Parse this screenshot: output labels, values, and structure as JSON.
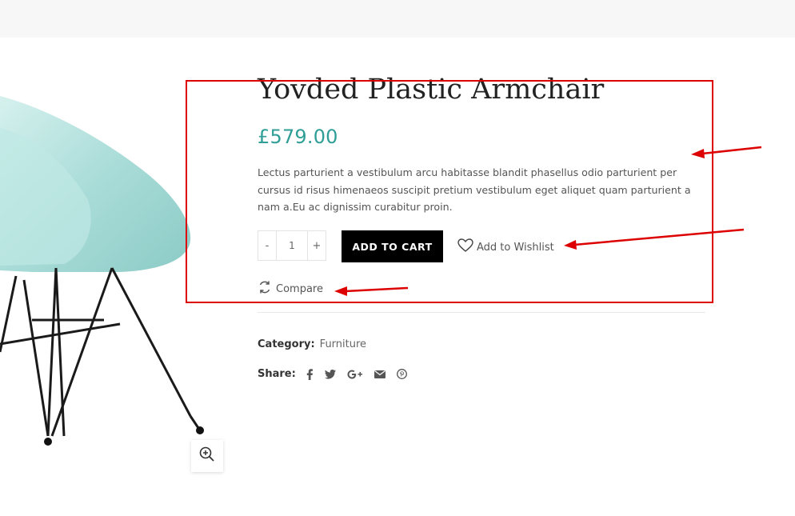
{
  "product": {
    "title": "Yovded Plastic Armchair",
    "price": "£579.00",
    "description": "Lectus parturient a vestibulum arcu habitasse blandit phasellus odio parturient per cursus id risus himenaeos suscipit pretium vestibulum eget aliquet quam parturient a nam a.Eu ac dignissim curabitur proin.",
    "quantity": "1"
  },
  "actions": {
    "minus": "-",
    "plus": "+",
    "add_to_cart": "ADD TO CART",
    "wishlist": "Add to Wishlist",
    "compare": "Compare"
  },
  "meta": {
    "category_label": "Category:",
    "category_value": "Furniture",
    "share_label": "Share:",
    "share_icons": [
      "facebook-icon",
      "twitter-icon",
      "google-plus-icon",
      "email-icon",
      "pinterest-icon"
    ]
  },
  "colors": {
    "price": "#2f9e96",
    "cart_button": "#000000",
    "annotation": "#dd0000",
    "chair": "#a9dcd8"
  }
}
